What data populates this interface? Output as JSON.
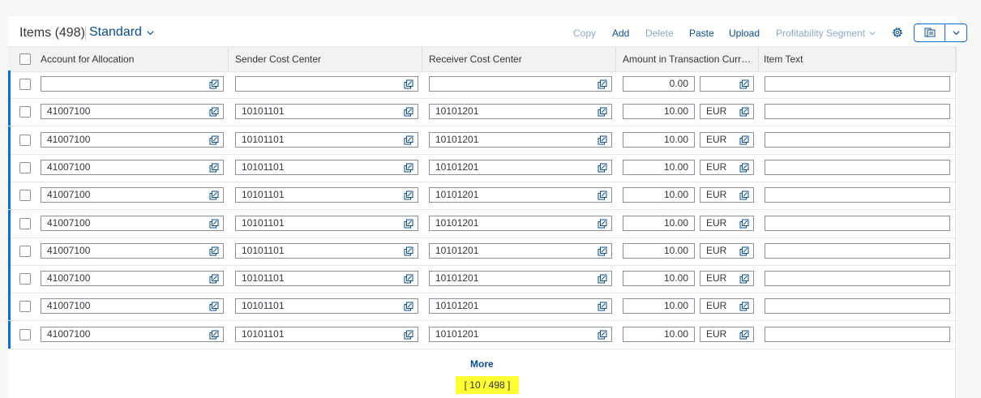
{
  "toolbar": {
    "title": "Items (498)",
    "variant": "Standard",
    "buttons": [
      {
        "label": "Copy",
        "enabled": false
      },
      {
        "label": "Add",
        "enabled": true
      },
      {
        "label": "Delete",
        "enabled": false
      },
      {
        "label": "Paste",
        "enabled": true
      },
      {
        "label": "Upload",
        "enabled": true
      },
      {
        "label": "Profitability Segment",
        "enabled": false
      }
    ],
    "settings_icon": "gear-icon",
    "export_icon": "export-icon"
  },
  "columns": [
    "Account for Allocation",
    "Sender Cost Center",
    "Receiver Cost Center",
    "Amount in Transaction Curre...",
    "Item Text"
  ],
  "rows": [
    {
      "account": "",
      "sender": "",
      "receiver": "",
      "amount": "0.00",
      "currency": "",
      "text": ""
    },
    {
      "account": "41007100",
      "sender": "10101101",
      "receiver": "10101201",
      "amount": "10.00",
      "currency": "EUR",
      "text": ""
    },
    {
      "account": "41007100",
      "sender": "10101101",
      "receiver": "10101201",
      "amount": "10.00",
      "currency": "EUR",
      "text": ""
    },
    {
      "account": "41007100",
      "sender": "10101101",
      "receiver": "10101201",
      "amount": "10.00",
      "currency": "EUR",
      "text": ""
    },
    {
      "account": "41007100",
      "sender": "10101101",
      "receiver": "10101201",
      "amount": "10.00",
      "currency": "EUR",
      "text": ""
    },
    {
      "account": "41007100",
      "sender": "10101101",
      "receiver": "10101201",
      "amount": "10.00",
      "currency": "EUR",
      "text": ""
    },
    {
      "account": "41007100",
      "sender": "10101101",
      "receiver": "10101201",
      "amount": "10.00",
      "currency": "EUR",
      "text": ""
    },
    {
      "account": "41007100",
      "sender": "10101101",
      "receiver": "10101201",
      "amount": "10.00",
      "currency": "EUR",
      "text": ""
    },
    {
      "account": "41007100",
      "sender": "10101101",
      "receiver": "10101201",
      "amount": "10.00",
      "currency": "EUR",
      "text": ""
    },
    {
      "account": "41007100",
      "sender": "10101101",
      "receiver": "10101201",
      "amount": "10.00",
      "currency": "EUR",
      "text": ""
    }
  ],
  "footer": {
    "more": "More",
    "counter": "[ 10 / 498 ]"
  },
  "colors": {
    "accent": "#0a6ed1",
    "link": "#0a4d8c",
    "highlight": "#ffff33"
  }
}
